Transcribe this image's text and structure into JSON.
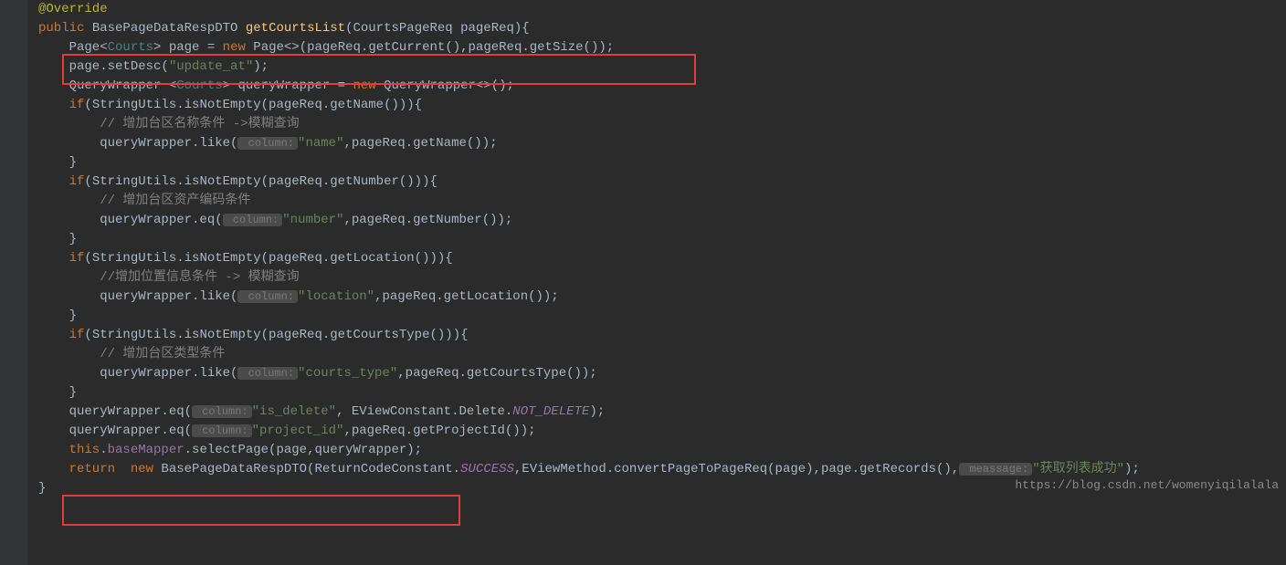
{
  "code": {
    "l01": "@Override",
    "l02_kw1": "public",
    "l02_type": " BasePageDataRespDTO ",
    "l02_method": "getCourtsList",
    "l02_after": "(CourtsPageReq pageReq){",
    "l03": "",
    "l04_pre": "    Page<",
    "l04_generic": "Courts",
    "l04_mid": "> page = ",
    "l04_new": "new",
    "l04_after": " Page<>(pageReq.getCurrent(),pageReq.getSize());",
    "l05_pre": "    page.setDesc(",
    "l05_str": "\"update_at\"",
    "l05_after": ");",
    "l06_pre": "    QueryWrapper <",
    "l06_generic": "Courts",
    "l06_mid": "> queryWrapper = ",
    "l06_new": "new",
    "l06_after": " QueryWrapper<>();",
    "l07": "",
    "l08_if": "    if",
    "l08_body": "(StringUtils.isNotEmpty(pageReq.getName())){",
    "l09_c": "        // 增加台区名称条件 ->模糊查询",
    "l10_pre": "        queryWrapper.like(",
    "l10_hint": " column:",
    "l10_str": "\"name\"",
    "l10_after": ",pageReq.getName());",
    "l11": "    }",
    "l12_if": "    if",
    "l12_body": "(StringUtils.isNotEmpty(pageReq.getNumber())){",
    "l13_c": "        // 增加台区资产编码条件",
    "l14_pre": "        queryWrapper.eq(",
    "l14_hint": " column:",
    "l14_str": "\"number\"",
    "l14_after": ",pageReq.getNumber());",
    "l15": "    }",
    "l16_if": "    if",
    "l16_body": "(StringUtils.isNotEmpty(pageReq.getLocation())){",
    "l17_c": "        //增加位置信息条件 -> 模糊查询",
    "l18_pre": "        queryWrapper.like(",
    "l18_hint": " column:",
    "l18_str": "\"location\"",
    "l18_after": ",pageReq.getLocation());",
    "l19": "    }",
    "l20_if": "    if",
    "l20_body": "(StringUtils.isNotEmpty(pageReq.getCourtsType())){",
    "l21_c": "        // 增加台区类型条件",
    "l22_pre": "        queryWrapper.like(",
    "l22_hint": " column:",
    "l22_str": "\"courts_type\"",
    "l22_after": ",pageReq.getCourtsType());",
    "l23": "    }",
    "l24_pre": "    queryWrapper.eq(",
    "l24_hint": " column:",
    "l24_str": "\"is_delete\"",
    "l24_mid": ", EViewConstant.Delete.",
    "l24_ital": "NOT_DELETE",
    "l24_after": ");",
    "l25_pre": "    queryWrapper.eq(",
    "l25_hint": " column:",
    "l25_str": "\"project_id\"",
    "l25_after": ",pageReq.getProjectId());",
    "l26": "",
    "l27_this": "    this",
    "l27_dot": ".",
    "l27_field": "baseMapper",
    "l27_after": ".selectPage(page,queryWrapper);",
    "l28_ret": "    return  new",
    "l28_a": " BasePageDataRespDTO(ReturnCodeConstant.",
    "l28_ital": "SUCCESS",
    "l28_b": ",EViewMethod.convertPageToPageReq(page),page.getRecords(),",
    "l28_hint": " meassage:",
    "l28_str": "\"获取列表成功\"",
    "l28_end": ");",
    "l29": "}"
  },
  "watermark": "https://blog.csdn.net/womenyiqilalala"
}
